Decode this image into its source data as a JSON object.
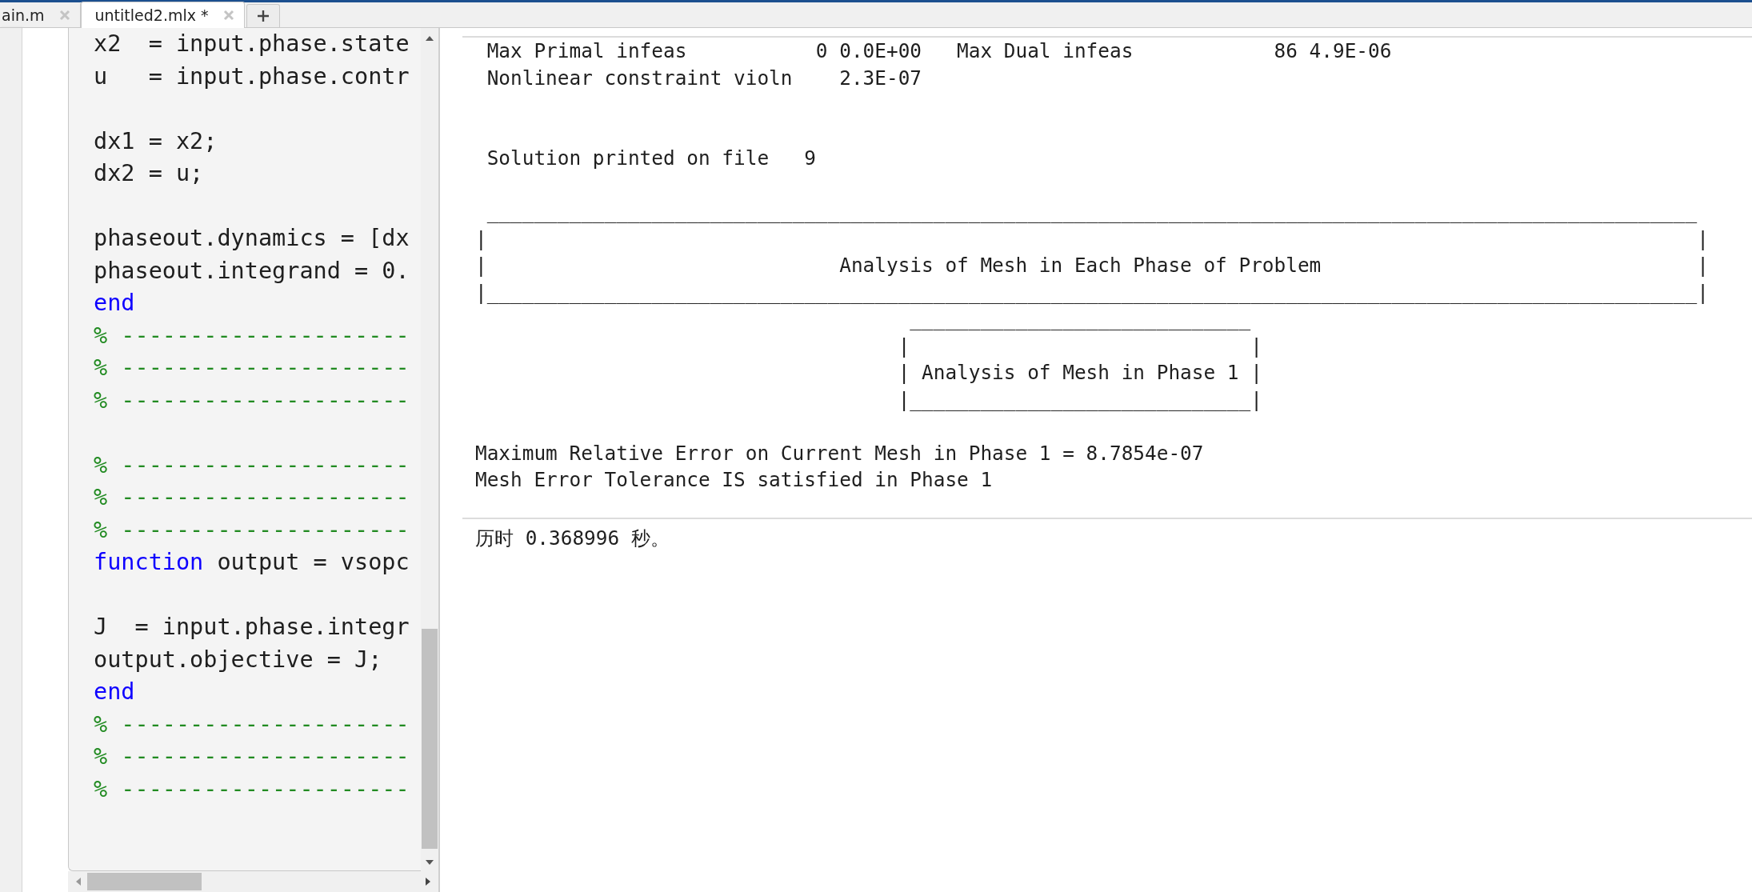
{
  "tabs": [
    {
      "label": "ain.m",
      "selected": false
    },
    {
      "label": "untitled2.mlx *",
      "selected": true
    }
  ],
  "editor": {
    "blocks": [
      {
        "lines": [
          [
            {
              "text": "x2  = input.phase.state",
              "kind": "plain"
            }
          ],
          [
            {
              "text": "u   = input.phase.contr",
              "kind": "plain"
            }
          ]
        ]
      },
      {
        "lines": [
          [
            {
              "text": "dx1 = x2;",
              "kind": "plain"
            }
          ],
          [
            {
              "text": "dx2 = u;",
              "kind": "plain"
            }
          ]
        ]
      },
      {
        "lines": [
          [
            {
              "text": "phaseout.dynamics = [dx",
              "kind": "plain"
            }
          ],
          [
            {
              "text": "phaseout.integrand = 0.",
              "kind": "plain"
            }
          ],
          [
            {
              "text": "end",
              "kind": "keyword"
            }
          ],
          [
            {
              "text": "% ---------------------",
              "kind": "comment"
            }
          ],
          [
            {
              "text": "% ---------------------",
              "kind": "comment"
            }
          ],
          [
            {
              "text": "% ---------------------",
              "kind": "comment"
            }
          ]
        ]
      },
      {
        "lines": [
          [
            {
              "text": "% ---------------------",
              "kind": "comment"
            }
          ],
          [
            {
              "text": "% ---------------------",
              "kind": "comment"
            }
          ],
          [
            {
              "text": "% ---------------------",
              "kind": "comment"
            }
          ],
          [
            {
              "text": "function",
              "kind": "keyword"
            },
            {
              "text": " output = vsopc",
              "kind": "plain"
            }
          ]
        ]
      },
      {
        "lines": [
          [
            {
              "text": "J  = input.phase.integr",
              "kind": "plain"
            }
          ],
          [
            {
              "text": "output.objective = J;",
              "kind": "plain"
            }
          ],
          [
            {
              "text": "end",
              "kind": "keyword"
            }
          ],
          [
            {
              "text": "% ---------------------",
              "kind": "comment"
            }
          ],
          [
            {
              "text": "% ---------------------",
              "kind": "comment"
            }
          ],
          [
            {
              "text": "% ---------------------",
              "kind": "comment"
            }
          ]
        ]
      }
    ]
  },
  "output": {
    "sections": [
      {
        "kind": "stats",
        "lines": [
          " Max Primal infeas           0 0.0E+00   Max Dual infeas            86 4.9E-06",
          " Nonlinear constraint violn    2.3E-07"
        ]
      },
      {
        "kind": "note",
        "lines": [
          " Solution printed on file   9"
        ]
      },
      {
        "kind": "banner",
        "lines": [
          " _______________________________________________________________________________________________________",
          "|                                                                                                       |",
          "|                              Analysis of Mesh in Each Phase of Problem                                |",
          "|_______________________________________________________________________________________________________|",
          "                                     _____________________________",
          "                                    |                             |",
          "                                    | Analysis of Mesh in Phase 1 |",
          "                                    |_____________________________|"
        ]
      },
      {
        "kind": "report",
        "lines": [
          "Maximum Relative Error on Current Mesh in Phase 1 = 8.7854e-07",
          "Mesh Error Tolerance IS satisfied in Phase 1"
        ]
      }
    ],
    "elapsed": "历时 0.368996 秒。"
  }
}
